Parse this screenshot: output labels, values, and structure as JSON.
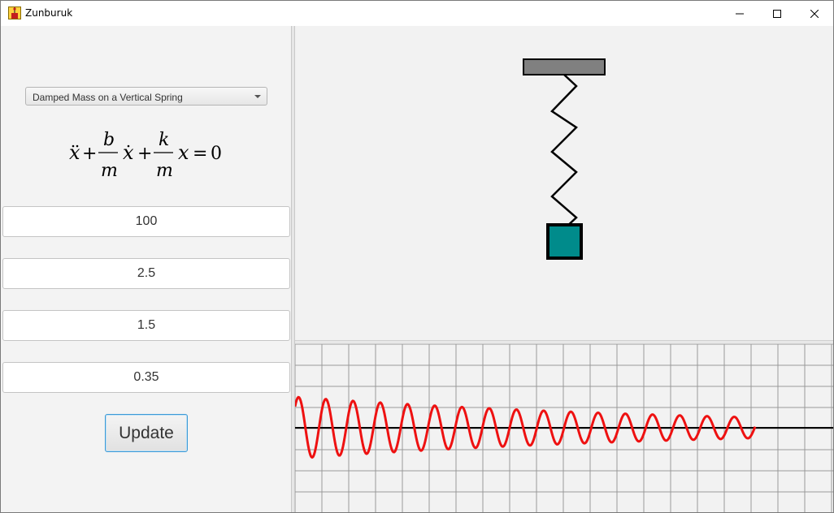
{
  "window": {
    "title": "Zunburuk"
  },
  "controls": {
    "system_selected": "Damped Mass on a Vertical Spring",
    "equation": {
      "x": "x",
      "plus": "+",
      "b": "b",
      "m": "m",
      "k": "k",
      "eq": "=",
      "zero": "0"
    },
    "fields": [
      "100",
      "2.5",
      "1.5",
      "0.35"
    ],
    "update_label": "Update"
  },
  "colors": {
    "ceiling": "#808080",
    "mass": "#008b8b",
    "trace": "#ee1111",
    "grid": "#999999"
  },
  "icons": {
    "app": "app-icon",
    "minimize": "minimize-icon",
    "maximize": "maximize-icon",
    "close": "close-icon"
  }
}
